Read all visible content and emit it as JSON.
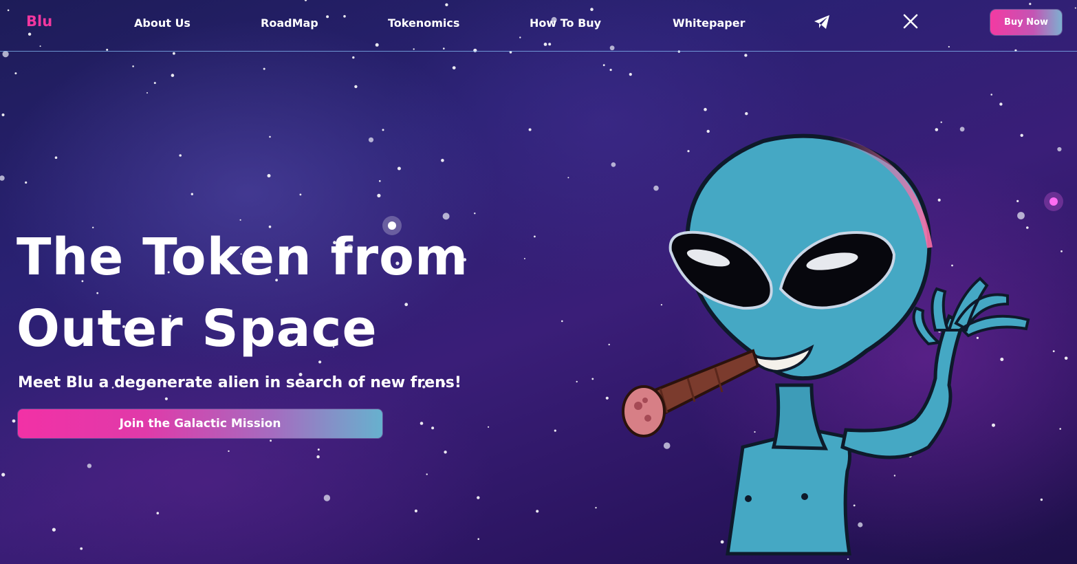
{
  "brand": {
    "logo": "Blu",
    "accent_color": "#f2379f"
  },
  "nav": {
    "links": [
      "About Us",
      "RoadMap",
      "Tokenomics",
      "How To Buy",
      "Whitepaper"
    ],
    "icons": [
      "telegram-icon",
      "x-twitter-icon"
    ],
    "buy_button": "Buy Now"
  },
  "hero": {
    "title_line1": "The Token from",
    "title_line2": "Outer Space",
    "subtitle": "Meet Blu a degenerate alien in search of new frens!",
    "cta": "Join the Galactic Mission"
  },
  "colors": {
    "cta_gradient_start": "#f231a6",
    "cta_gradient_end": "#67b1ce",
    "alien_skin": "#45a8c4"
  }
}
